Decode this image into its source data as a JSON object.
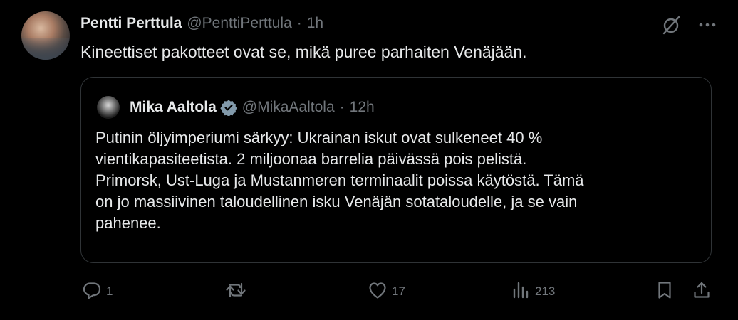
{
  "tweet": {
    "author_name": "Pentti Perttula",
    "author_handle": "@PenttiPerttula",
    "separator": "·",
    "time": "1h",
    "text": "Kineettiset pakotteet ovat se, mikä puree parhaiten Venäjään."
  },
  "quote": {
    "author_name": "Mika Aaltola",
    "author_handle": "@MikaAaltola",
    "separator": "·",
    "time": "12h",
    "lines": [
      "Putinin öljyimperiumi särkyy: Ukrainan iskut ovat sulkeneet 40 %",
      "vientikapasiteetista. 2 miljoonaa barrelia päivässä pois pelistä.",
      "Primorsk, Ust-Luga ja Mustanmeren terminaalit poissa käytöstä. Tämä",
      "on jo massiivinen taloudellinen isku Venäjän sotataloudelle, ja se vain",
      "pahenee."
    ]
  },
  "metrics": {
    "replies": "1",
    "reposts": "",
    "likes": "17",
    "views": "213"
  },
  "icons": {
    "grok": "grok-icon",
    "more": "more-icon",
    "reply": "reply-icon",
    "repost": "repost-icon",
    "like": "like-icon",
    "views": "views-icon",
    "bookmark": "bookmark-icon",
    "share": "share-icon"
  },
  "colors": {
    "background": "#000000",
    "text": "#e7e9ea",
    "muted": "#71767b",
    "border": "#2f3336",
    "verified": "#829aab"
  }
}
